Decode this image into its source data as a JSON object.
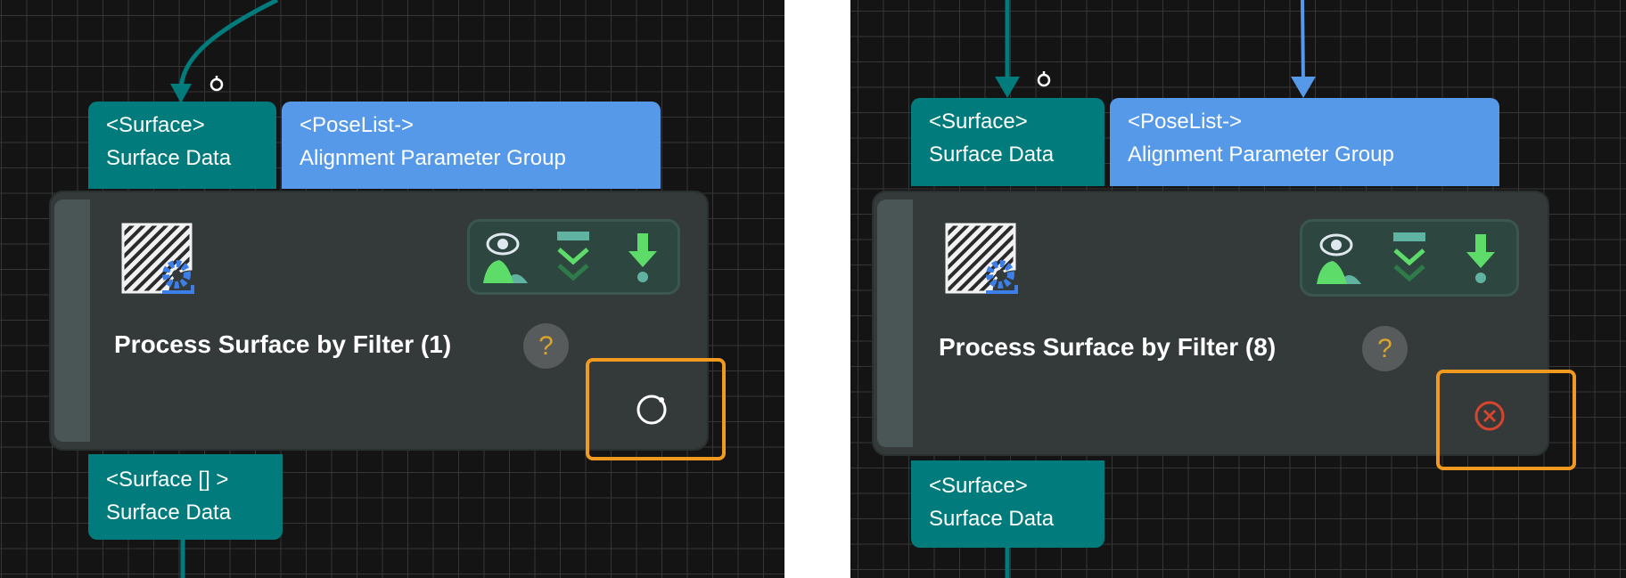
{
  "left": {
    "input_ports": [
      {
        "type": "<Surface>",
        "name": "Surface Data"
      },
      {
        "type": "<PoseList->",
        "name": "Alignment Parameter Group"
      }
    ],
    "node_title": "Process Surface by Filter (1)",
    "help": "?",
    "status_icon": "refresh-circle-icon",
    "output_port": {
      "type": "<Surface [] >",
      "name": "Surface Data"
    }
  },
  "right": {
    "input_ports": [
      {
        "type": "<Surface>",
        "name": "Surface Data"
      },
      {
        "type": "<PoseList->",
        "name": "Alignment Parameter Group"
      }
    ],
    "node_title": "Process Surface by Filter (8)",
    "help": "?",
    "status_icon": "error-circle-icon",
    "output_port": {
      "type": "<Surface>",
      "name": "Surface Data"
    }
  },
  "colors": {
    "teal": "#017b7b",
    "blue": "#5599e8",
    "highlight": "#f29a1f",
    "error": "#d8452e",
    "help": "#d9a42c"
  }
}
